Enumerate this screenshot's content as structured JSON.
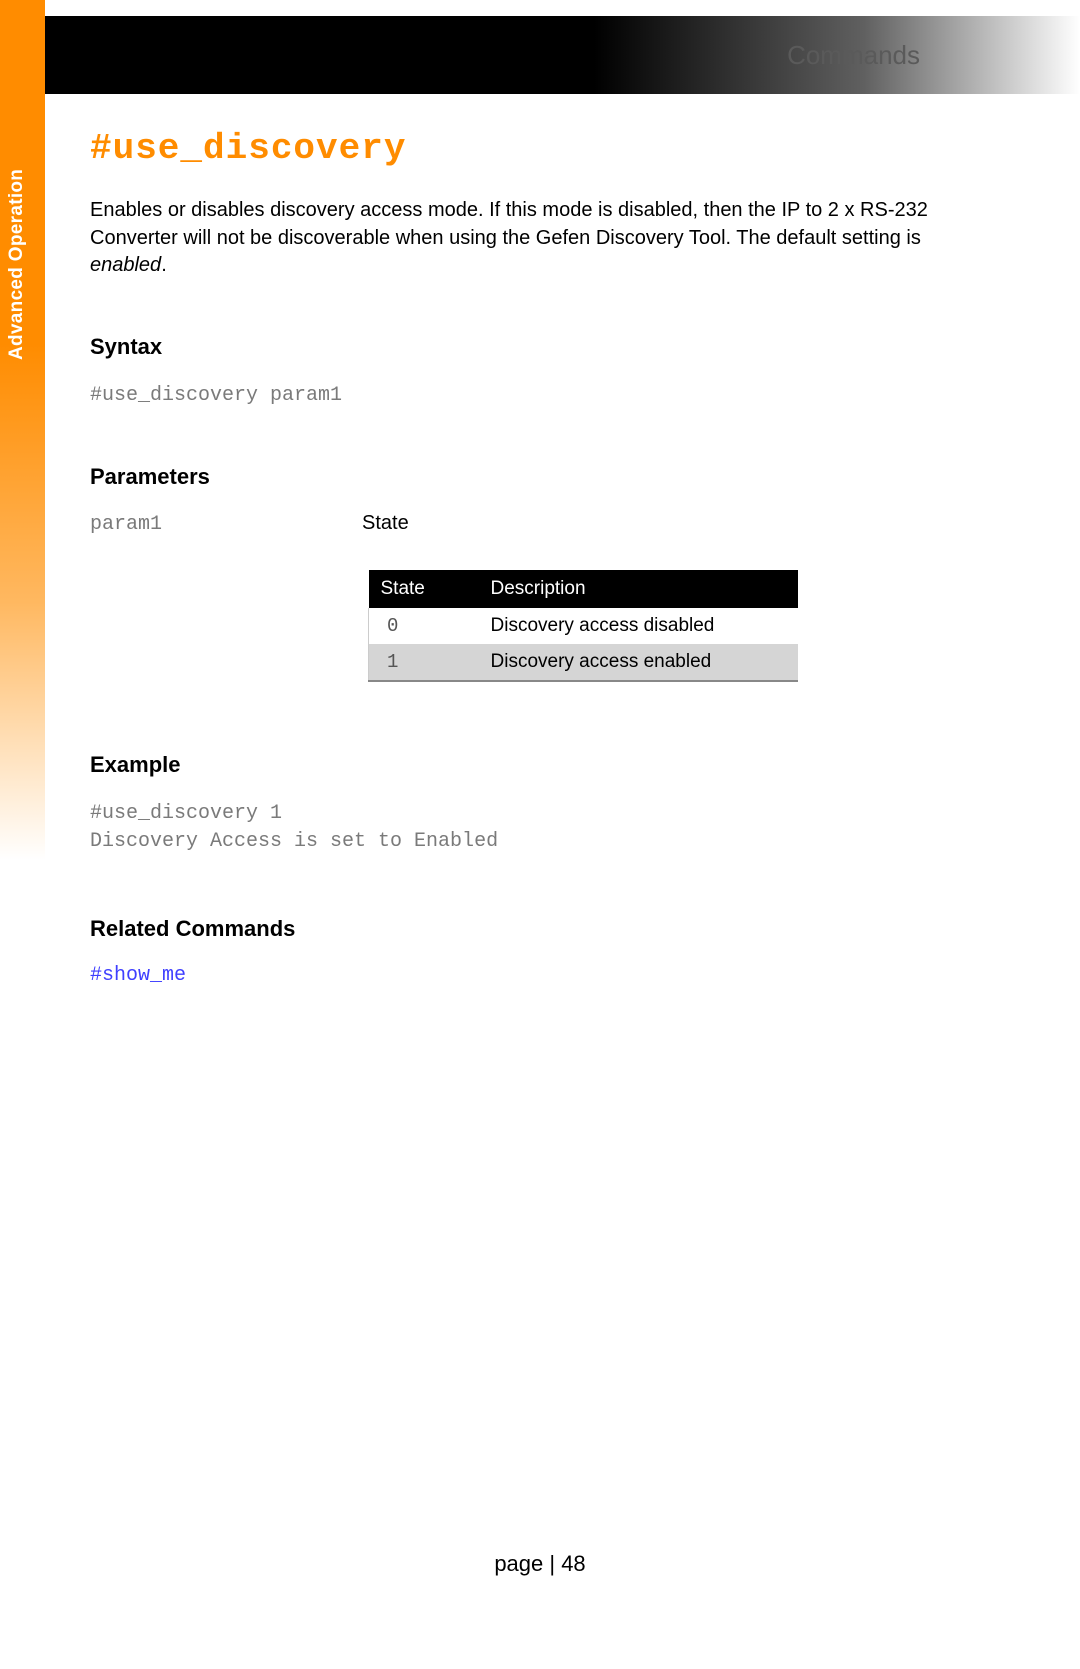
{
  "sidebar": {
    "label": "Advanced Operation"
  },
  "topbar": {
    "title": "Commands"
  },
  "page": {
    "title": "#use_discovery",
    "intro_plain_prefix": "Enables or disables discovery access mode. If this mode is disabled, then the IP to 2 x RS-232 Converter will not be discoverable when using the Gefen Discovery Tool. The default setting is ",
    "intro_em": "enabled",
    "intro_suffix": "."
  },
  "syntax": {
    "heading": "Syntax",
    "code": "#use_discovery param1"
  },
  "parameters": {
    "heading": "Parameters",
    "param_name": "param1",
    "param_type": "State",
    "table": {
      "col1": "State",
      "col2": "Description",
      "rows": [
        {
          "state": "0",
          "desc": "Discovery access disabled"
        },
        {
          "state": "1",
          "desc": "Discovery access enabled"
        }
      ]
    }
  },
  "example": {
    "heading": "Example",
    "code": "#use_discovery 1\nDiscovery Access is set to Enabled"
  },
  "related": {
    "heading": "Related Commands",
    "links": [
      "#show_me"
    ]
  },
  "footer": {
    "page_label": "page | 48"
  }
}
